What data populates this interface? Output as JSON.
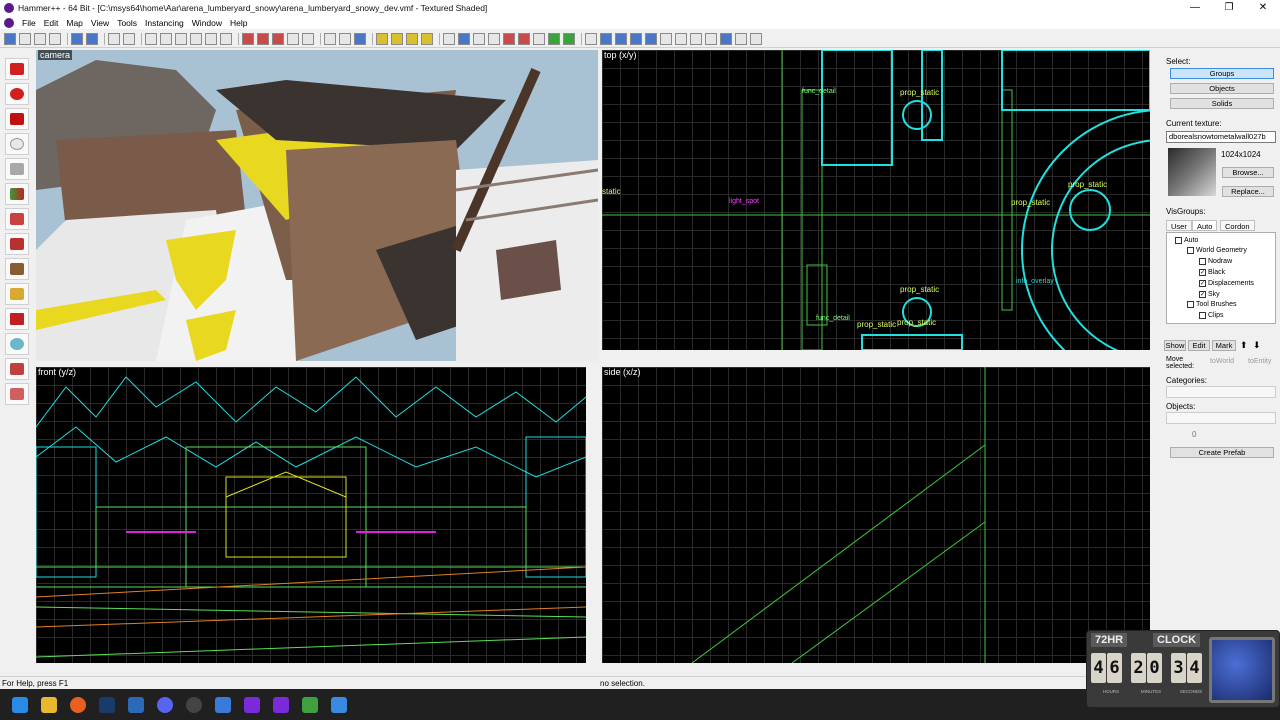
{
  "window": {
    "title": "Hammer++ - 64 Bit - [C:\\msys64\\home\\Aar\\arena_lumberyard_snowy\\arena_lumberyard_snowy_dev.vmf - Textured Shaded]",
    "controls": [
      "—",
      "❐",
      "✕"
    ]
  },
  "menu": [
    "File",
    "Edit",
    "Map",
    "View",
    "Tools",
    "Instancing",
    "Window",
    "Help"
  ],
  "viewports": {
    "camera": "camera",
    "top": "top (x/y)",
    "front": "front (y/z)",
    "side": "side (x/z)"
  },
  "top_labels": [
    {
      "text": "prop_static",
      "color": "#d8ff60"
    },
    {
      "text": "func_detail",
      "color": "#7cff7c"
    },
    {
      "text": "light_spot",
      "color": "#ff40ff"
    },
    {
      "text": "static",
      "color": "#d8ff60"
    },
    {
      "text": "prop_static",
      "color": "#d8ff60"
    },
    {
      "text": "prop_static",
      "color": "#d8ff60"
    },
    {
      "text": "prop_static",
      "color": "#d8ff60"
    },
    {
      "text": "info_overlay",
      "color": "#30d0d0"
    },
    {
      "text": "func_detail",
      "color": "#7cff7c"
    },
    {
      "text": "prop_static",
      "color": "#d8ff60"
    },
    {
      "text": "prop_static",
      "color": "#d8ff60"
    }
  ],
  "panel": {
    "select_label": "Select:",
    "groups": "Groups",
    "objects": "Objects",
    "solids": "Solids",
    "current_texture_label": "Current texture:",
    "texture_name": "dborealsnowtometalwall027b",
    "texture_size": "1024x1024",
    "browse": "Browse...",
    "replace": "Replace...",
    "visgroups_label": "VisGroups:",
    "tabs": [
      "User",
      "Auto",
      "Cordon"
    ],
    "tree": [
      {
        "label": "Auto",
        "indent": 0,
        "checked": false
      },
      {
        "label": "World Geometry",
        "indent": 1,
        "checked": false
      },
      {
        "label": "Nodraw",
        "indent": 2,
        "checked": false
      },
      {
        "label": "Black",
        "indent": 2,
        "checked": true
      },
      {
        "label": "Displacements",
        "indent": 2,
        "checked": true
      },
      {
        "label": "Sky",
        "indent": 2,
        "checked": true
      },
      {
        "label": "Tool Brushes",
        "indent": 1,
        "checked": false
      },
      {
        "label": "Clips",
        "indent": 2,
        "checked": false
      }
    ],
    "show": "Show",
    "edit": "Edit",
    "mark": "Mark",
    "move_selected": "Move selected:",
    "to_world": "toWorld",
    "to_entity": "toEntity",
    "categories_label": "Categories:",
    "objects_label": "Objects:",
    "count": "0",
    "create_prefab": "Create Prefab"
  },
  "status": {
    "help": "For Help, press F1",
    "selection": "no selection."
  },
  "clock": {
    "title_a": "72HR",
    "title_b": "CLOCK",
    "digits": [
      "4",
      "6",
      "2",
      "0",
      "3",
      "4"
    ],
    "units": [
      "HOURS",
      "MINUTES",
      "SECONDS"
    ]
  },
  "taskbar_icons": [
    "windows-icon",
    "folder-icon",
    "firefox-icon",
    "steam-icon",
    "vscode-icon",
    "discord-icon",
    "obs-icon",
    "m-icon",
    "hammer-icon",
    "hammer2-icon",
    "notepad-icon",
    "app-icon"
  ]
}
